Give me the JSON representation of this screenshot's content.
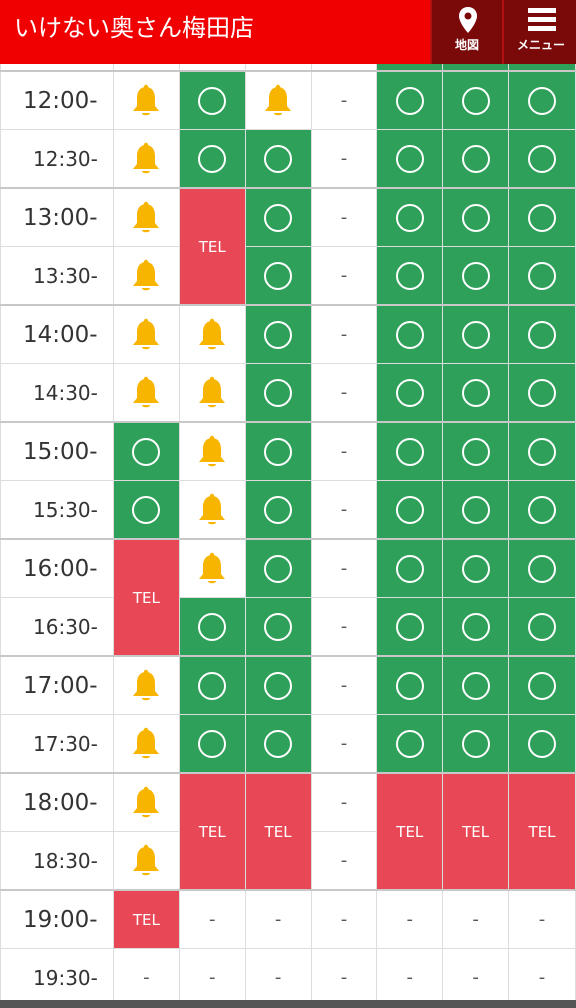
{
  "header": {
    "title": "いけない奥さん梅田店",
    "map_label": "地図",
    "menu_label": "メニュー",
    "background_color": "#f00000",
    "button_color": "#7a0a0a"
  },
  "colors": {
    "available": "#2ea05a",
    "tel": "#e84855",
    "bell": "#f7b500"
  },
  "legend": {
    "tel": "TEL",
    "dash": "-"
  },
  "schedule": {
    "times": [
      "12:00-",
      "12:30-",
      "13:00-",
      "13:30-",
      "14:00-",
      "14:30-",
      "15:00-",
      "15:30-",
      "16:00-",
      "16:30-",
      "17:00-",
      "17:30-",
      "18:00-",
      "18:30-",
      "19:00-",
      "19:30-"
    ],
    "columns": [
      [
        "bell",
        "bell",
        "bell",
        "bell",
        "bell",
        "bell",
        "available",
        "available",
        "tel",
        "tel",
        "bell",
        "bell",
        "bell",
        "bell",
        "tel",
        "dash"
      ],
      [
        "available",
        "available",
        "tel",
        "tel",
        "bell",
        "bell",
        "bell",
        "bell",
        "bell",
        "available",
        "available",
        "available",
        "tel",
        "tel",
        "dash",
        "dash"
      ],
      [
        "bell",
        "available",
        "available",
        "available",
        "available",
        "available",
        "available",
        "available",
        "available",
        "available",
        "available",
        "available",
        "tel",
        "tel",
        "dash",
        "dash"
      ],
      [
        "dash",
        "dash",
        "dash",
        "dash",
        "dash",
        "dash",
        "dash",
        "dash",
        "dash",
        "dash",
        "dash",
        "dash",
        "dash",
        "dash",
        "dash",
        "dash"
      ],
      [
        "available",
        "available",
        "available",
        "available",
        "available",
        "available",
        "available",
        "available",
        "available",
        "available",
        "available",
        "available",
        "tel",
        "tel",
        "dash",
        "dash"
      ],
      [
        "available",
        "available",
        "available",
        "available",
        "available",
        "available",
        "available",
        "available",
        "available",
        "available",
        "available",
        "available",
        "tel",
        "tel",
        "dash",
        "dash"
      ],
      [
        "available",
        "available",
        "available",
        "available",
        "available",
        "available",
        "available",
        "available",
        "available",
        "available",
        "available",
        "available",
        "tel",
        "tel",
        "dash",
        "dash"
      ]
    ]
  }
}
